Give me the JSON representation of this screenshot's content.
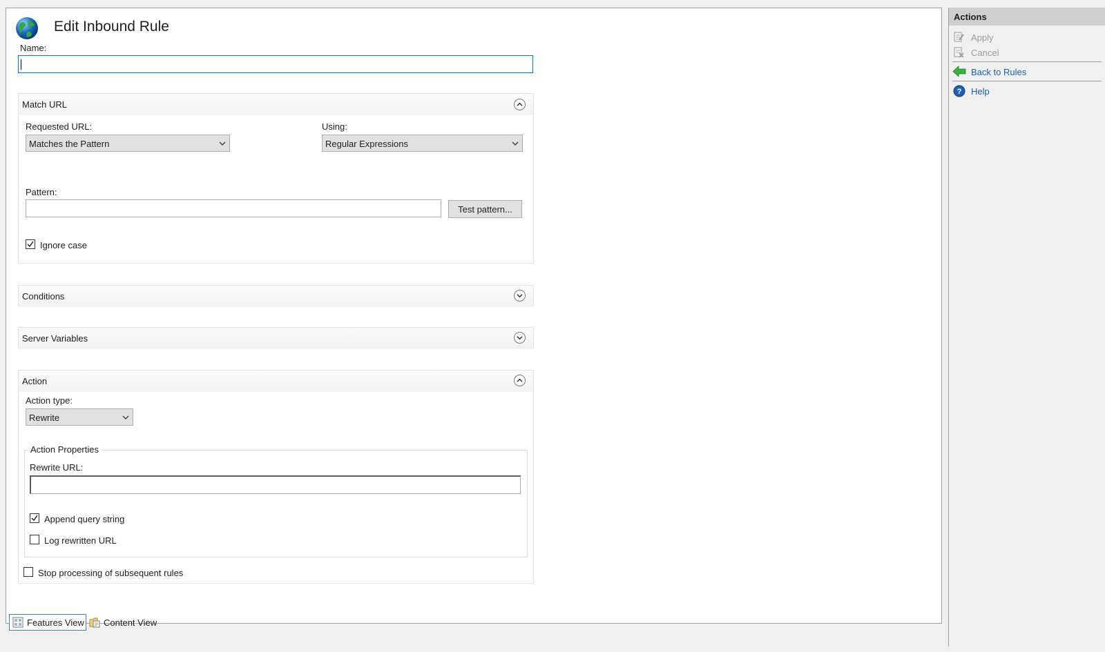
{
  "page": {
    "title": "Edit Inbound Rule",
    "name_label": "Name:",
    "name_value": ""
  },
  "match_url": {
    "header": "Match URL",
    "requested_url_label": "Requested URL:",
    "requested_url_value": "Matches the Pattern",
    "using_label": "Using:",
    "using_value": "Regular Expressions",
    "pattern_label": "Pattern:",
    "pattern_value": "",
    "test_pattern_button": "Test pattern...",
    "ignore_case_label": "Ignore case",
    "ignore_case_checked": true
  },
  "conditions": {
    "header": "Conditions"
  },
  "server_variables": {
    "header": "Server Variables"
  },
  "action": {
    "header": "Action",
    "action_type_label": "Action type:",
    "action_type_value": "Rewrite",
    "properties_legend": "Action Properties",
    "rewrite_url_label": "Rewrite URL:",
    "rewrite_url_value": "",
    "append_query_label": "Append query string",
    "append_query_checked": true,
    "log_rewritten_label": "Log rewritten URL",
    "log_rewritten_checked": false,
    "stop_processing_label": "Stop processing of subsequent rules",
    "stop_processing_checked": false
  },
  "actions_pane": {
    "title": "Actions",
    "apply": "Apply",
    "cancel": "Cancel",
    "back_to_rules": "Back to Rules",
    "help": "Help"
  },
  "bottom_tabs": {
    "features_view": "Features View",
    "content_view": "Content View"
  },
  "colors": {
    "accent": "#0078d7",
    "link": "#1a5fb4",
    "back_arrow": "#2ea043",
    "help_icon": "#1f5fb8"
  }
}
